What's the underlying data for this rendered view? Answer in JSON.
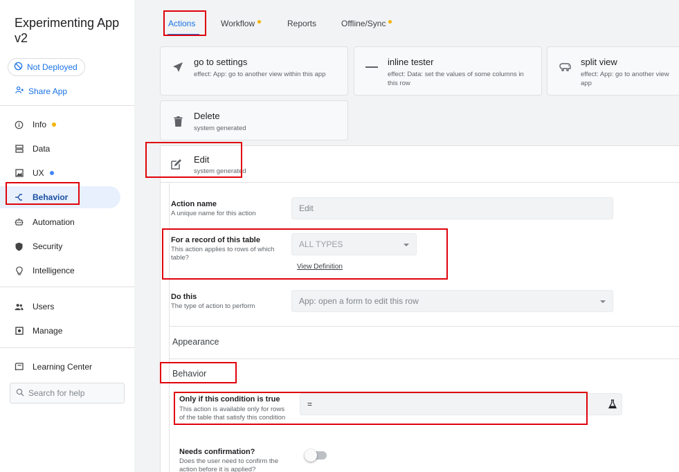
{
  "app": {
    "title": "Experimenting App v2"
  },
  "sidebar": {
    "deploy_status": "Not Deployed",
    "share_label": "Share App",
    "items": [
      {
        "label": "Info",
        "icon": "info-icon",
        "dot": "#f4b400"
      },
      {
        "label": "Data",
        "icon": "data-icon"
      },
      {
        "label": "UX",
        "icon": "ux-icon",
        "dot": "#4285f4"
      },
      {
        "label": "Behavior",
        "icon": "behavior-icon",
        "active": true
      },
      {
        "label": "Automation",
        "icon": "automation-icon"
      },
      {
        "label": "Security",
        "icon": "security-icon"
      },
      {
        "label": "Intelligence",
        "icon": "intelligence-icon"
      },
      {
        "label": "Users",
        "icon": "users-icon"
      },
      {
        "label": "Manage",
        "icon": "manage-icon"
      },
      {
        "label": "Learning Center",
        "icon": "learning-center-icon"
      }
    ],
    "search_placeholder": "Search for help"
  },
  "tabs": [
    {
      "label": "Actions",
      "active": true
    },
    {
      "label": "Workflow",
      "dot": true
    },
    {
      "label": "Reports"
    },
    {
      "label": "Offline/Sync",
      "dot": true
    }
  ],
  "actions": [
    {
      "title": "go to settings",
      "subtitle": "effect: App: go to another view within this app",
      "icon": "send-icon"
    },
    {
      "title": "inline tester",
      "subtitle": "effect: Data: set the values of some columns in this row",
      "icon": "minus-icon"
    },
    {
      "title": "split view",
      "subtitle": "effect: App: go to another view app",
      "icon": "hippo-icon"
    },
    {
      "title": "Delete",
      "subtitle": "system generated",
      "icon": "trash-icon"
    }
  ],
  "selected_action": {
    "title": "Edit",
    "subtitle": "system generated",
    "icon": "edit-icon"
  },
  "form": {
    "action_name": {
      "label": "Action name",
      "help": "A unique name for this action",
      "value": "Edit"
    },
    "record_table": {
      "label": "For a record of this table",
      "help": "This action applies to rows of which table?",
      "value": "ALL TYPES",
      "link": "View Definition"
    },
    "do_this": {
      "label": "Do this",
      "help": "The type of action to perform",
      "value": "App: open a form to edit this row"
    },
    "appearance_title": "Appearance",
    "behavior_title": "Behavior",
    "condition": {
      "label": "Only if this condition is true",
      "help": "This action is available only for rows of the table that satisfy this condition",
      "value": "="
    },
    "confirmation": {
      "label": "Needs confirmation?",
      "help": "Does the user need to confirm the action before it is applied?",
      "enabled": false
    }
  },
  "colors": {
    "accent": "#1a73e8",
    "highlight": "#e0000a",
    "active_bg": "#e8f0fe"
  }
}
